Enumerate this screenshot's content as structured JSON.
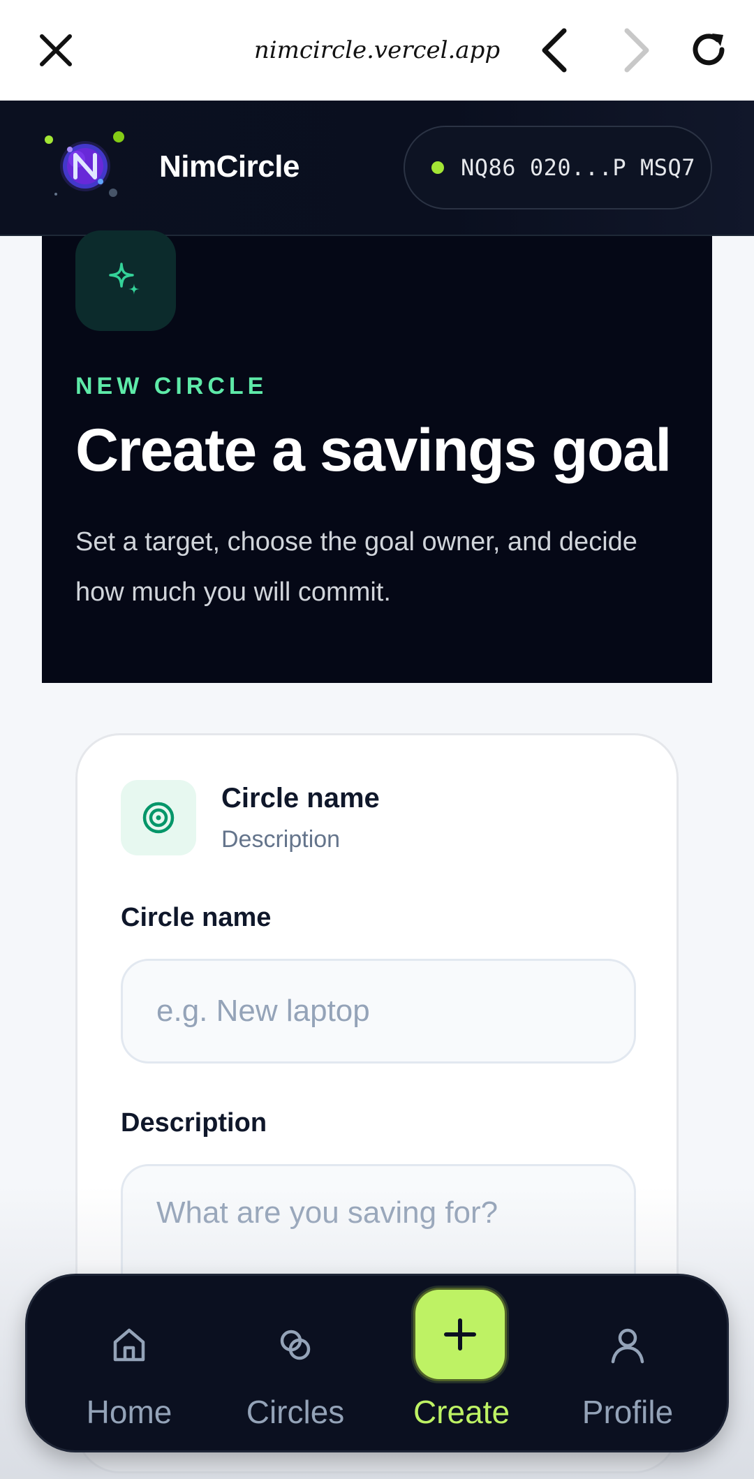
{
  "browser": {
    "url": "nimcircle.vercel.app"
  },
  "header": {
    "brand": "NimCircle",
    "wallet_address": "NQ86 020...P MSQ7",
    "wallet_status_color": "#a3e635"
  },
  "hero": {
    "eyebrow": "NEW CIRCLE",
    "title": "Create a savings goal",
    "subtitle": "Set a target, choose the goal owner, and decide how much you will commit.",
    "icon": "sparkles-icon"
  },
  "form": {
    "section_title": "Circle name",
    "section_subtitle": "Description",
    "section_icon": "target-icon",
    "fields": [
      {
        "label": "Circle name",
        "placeholder": "e.g. New laptop"
      },
      {
        "label": "Description",
        "placeholder": "What are you saving for?"
      }
    ]
  },
  "nav": {
    "items": [
      {
        "label": "Home",
        "icon": "home-icon"
      },
      {
        "label": "Circles",
        "icon": "circles-icon"
      },
      {
        "label": "Create",
        "icon": "plus-icon",
        "active": true
      },
      {
        "label": "Profile",
        "icon": "user-icon"
      }
    ],
    "accent": "#bef264"
  }
}
